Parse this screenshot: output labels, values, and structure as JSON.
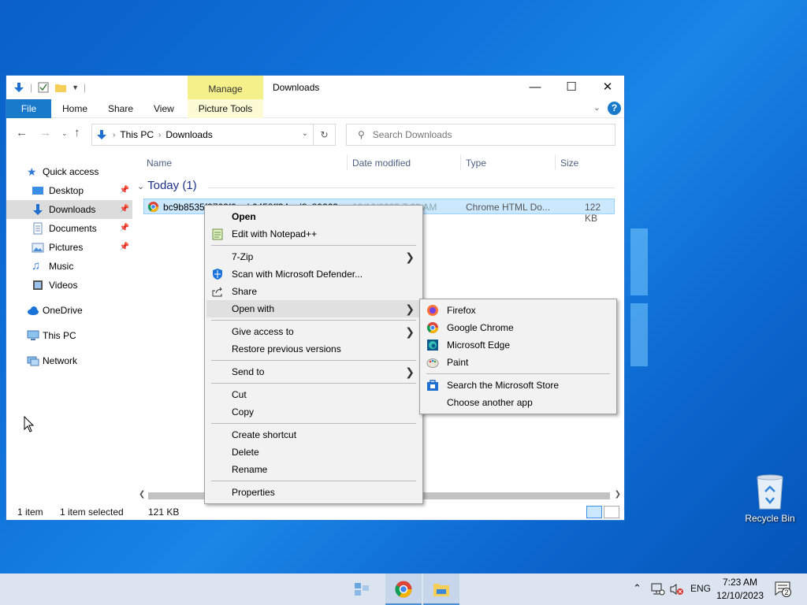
{
  "explorer": {
    "title": "Downloads",
    "manage_tab": "Manage",
    "ribbon_tabs": [
      "File",
      "Home",
      "Share",
      "View",
      "Picture Tools"
    ],
    "address": {
      "this_pc": "This PC",
      "downloads": "Downloads"
    },
    "search_placeholder": "Search Downloads",
    "columns": {
      "name": "Name",
      "date": "Date modified",
      "type": "Type",
      "size": "Size"
    },
    "group_label": "Today (1)",
    "file": {
      "name": "bc9b8535f2762f0...d.6458ff34...d8c80263",
      "date": "12/10/2023 7:23 AM",
      "type": "Chrome HTML Do...",
      "size": "122 KB"
    },
    "status": {
      "count": "1 item",
      "selected": "1 item selected",
      "size": "121 KB"
    }
  },
  "sidebar": {
    "quick_access": "Quick access",
    "items": [
      {
        "label": "Desktop",
        "icon": "desktop-icon",
        "pinned": true
      },
      {
        "label": "Downloads",
        "icon": "downloads-icon",
        "pinned": true
      },
      {
        "label": "Documents",
        "icon": "documents-icon",
        "pinned": true
      },
      {
        "label": "Pictures",
        "icon": "pictures-icon",
        "pinned": true
      },
      {
        "label": "Music",
        "icon": "music-icon",
        "pinned": false
      },
      {
        "label": "Videos",
        "icon": "videos-icon",
        "pinned": false
      }
    ],
    "onedrive": "OneDrive",
    "this_pc": "This PC",
    "network": "Network"
  },
  "context_menu": {
    "open": "Open",
    "edit_notepad": "Edit with Notepad++",
    "zip": "7-Zip",
    "defender": "Scan with Microsoft Defender...",
    "share": "Share",
    "open_with": "Open with",
    "give_access": "Give access to",
    "restore": "Restore previous versions",
    "send_to": "Send to",
    "cut": "Cut",
    "copy": "Copy",
    "create_shortcut": "Create shortcut",
    "delete": "Delete",
    "rename": "Rename",
    "properties": "Properties"
  },
  "open_with_menu": {
    "firefox": "Firefox",
    "chrome": "Google Chrome",
    "edge": "Microsoft Edge",
    "paint": "Paint",
    "store": "Search the Microsoft Store",
    "choose": "Choose another app"
  },
  "desktop": {
    "recycle_bin": "Recycle Bin"
  },
  "taskbar": {
    "language": "ENG",
    "time": "7:23 AM",
    "date": "12/10/2023",
    "notification_count": "2"
  },
  "colors": {
    "accent": "#1979ca",
    "selection": "#cce8ff",
    "manage": "#f6f08a"
  }
}
